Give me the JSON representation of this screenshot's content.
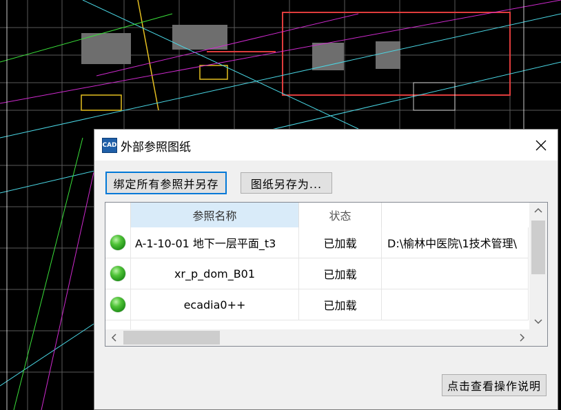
{
  "dialog": {
    "title": "外部参照图纸",
    "icon_text": "CAD",
    "bind_all_button": "绑定所有参照并另存",
    "save_as_button": "图纸另存为...",
    "help_button": "点击查看操作说明"
  },
  "table": {
    "headers": [
      "",
      "参照名称",
      "状态",
      ""
    ],
    "rows": [
      {
        "status_icon": "green-dot-icon",
        "name": "A-1-10-01 地下一层平面_t3",
        "state": "已加载",
        "path": "D:\\榆林中医院\\1技术管理\\"
      },
      {
        "status_icon": "green-dot-icon",
        "name": "xr_p_dom_B01",
        "state": "已加载",
        "path": ""
      },
      {
        "status_icon": "green-dot-icon",
        "name": "ecadia0++",
        "state": "已加载",
        "path": ""
      }
    ]
  },
  "colors": {
    "cad_background": "#000000",
    "dialog_bg": "#f0f0f0",
    "header_selected": "#d9ebf9",
    "default_button_border": "#0078d7"
  }
}
